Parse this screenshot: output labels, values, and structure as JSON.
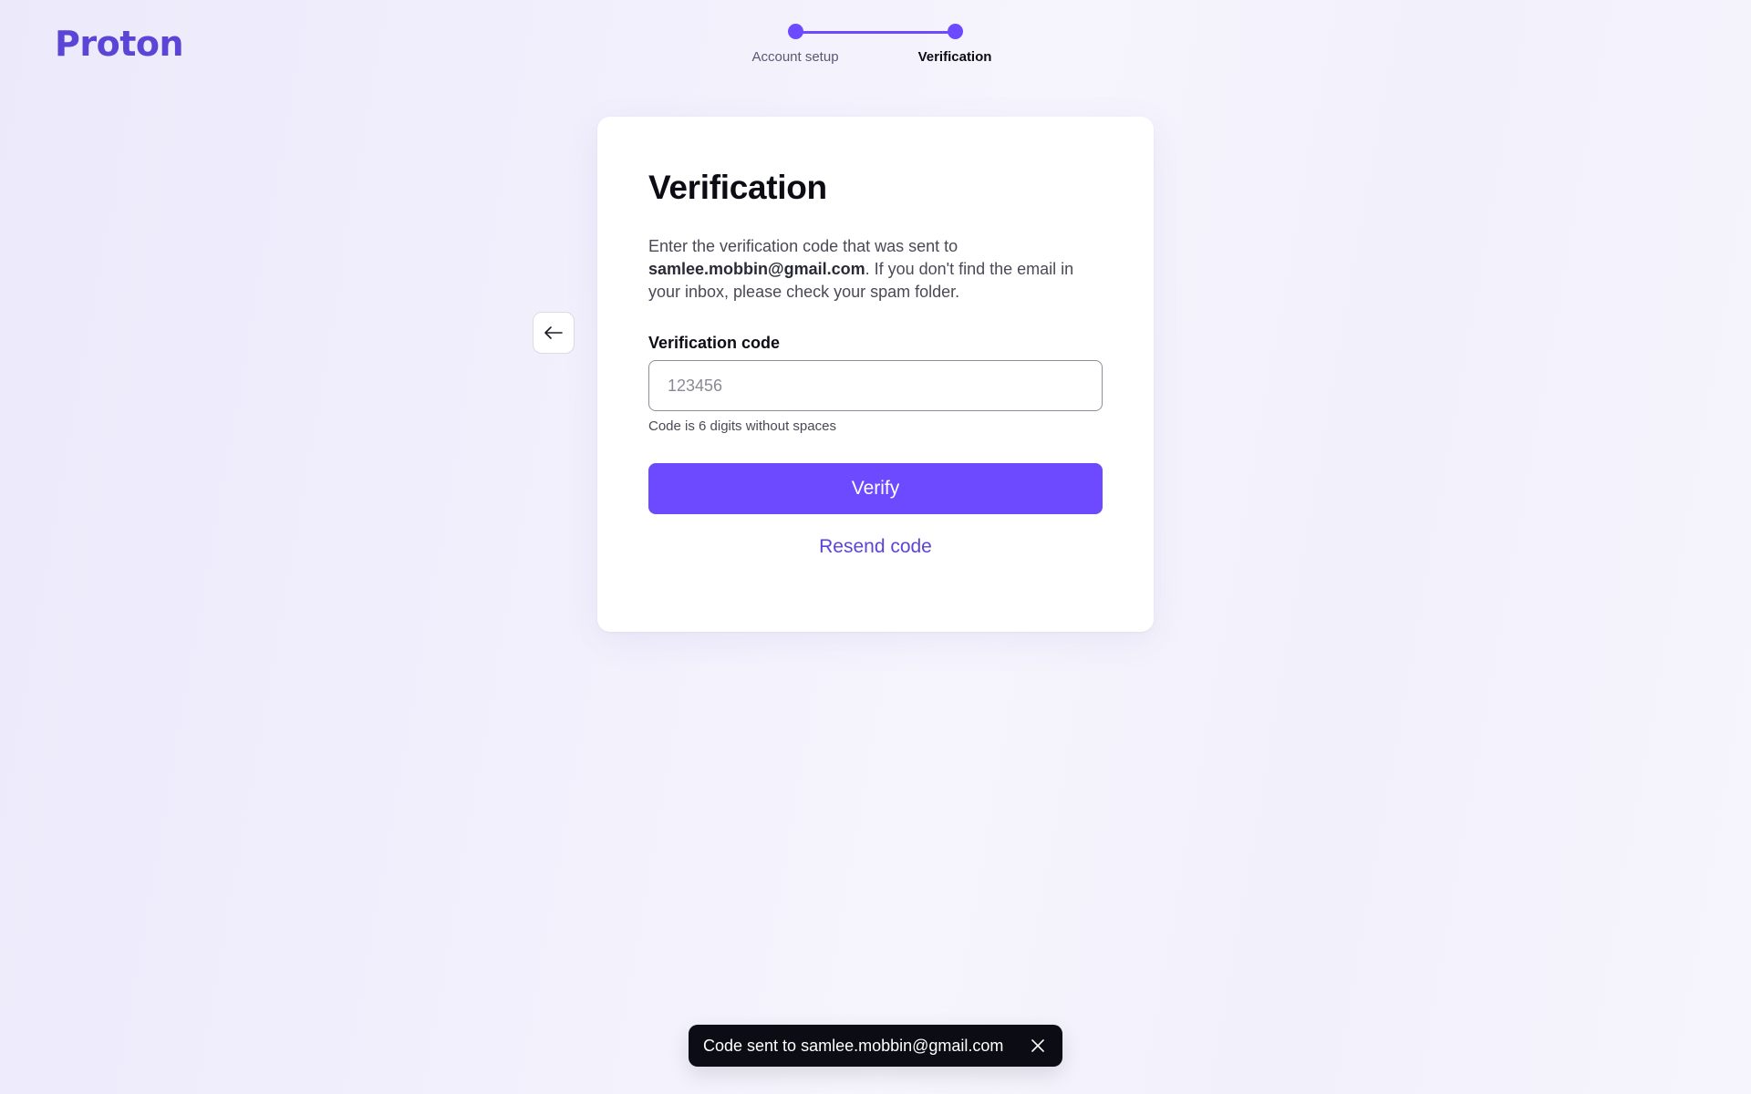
{
  "brand": {
    "logo_text": "Proton"
  },
  "stepper": {
    "steps": [
      {
        "label": "Account setup"
      },
      {
        "label": "Verification"
      }
    ]
  },
  "card": {
    "title": "Verification",
    "desc_prefix": "Enter the verification code that was sent to ",
    "email": "samlee.mobbin@gmail.com",
    "desc_suffix": ". If you don't find the email in your inbox, please check your spam folder.",
    "field_label": "Verification code",
    "input_placeholder": "123456",
    "input_value": "",
    "hint": "Code is 6 digits without spaces",
    "verify_label": "Verify",
    "resend_label": "Resend code"
  },
  "toast": {
    "message": "Code sent to samlee.mobbin@gmail.com"
  },
  "colors": {
    "accent": "#6d4aff",
    "brand": "#5a45d6",
    "toast_bg": "#0c0c14"
  },
  "icons": {
    "back": "arrow-left-icon",
    "close": "close-icon"
  }
}
